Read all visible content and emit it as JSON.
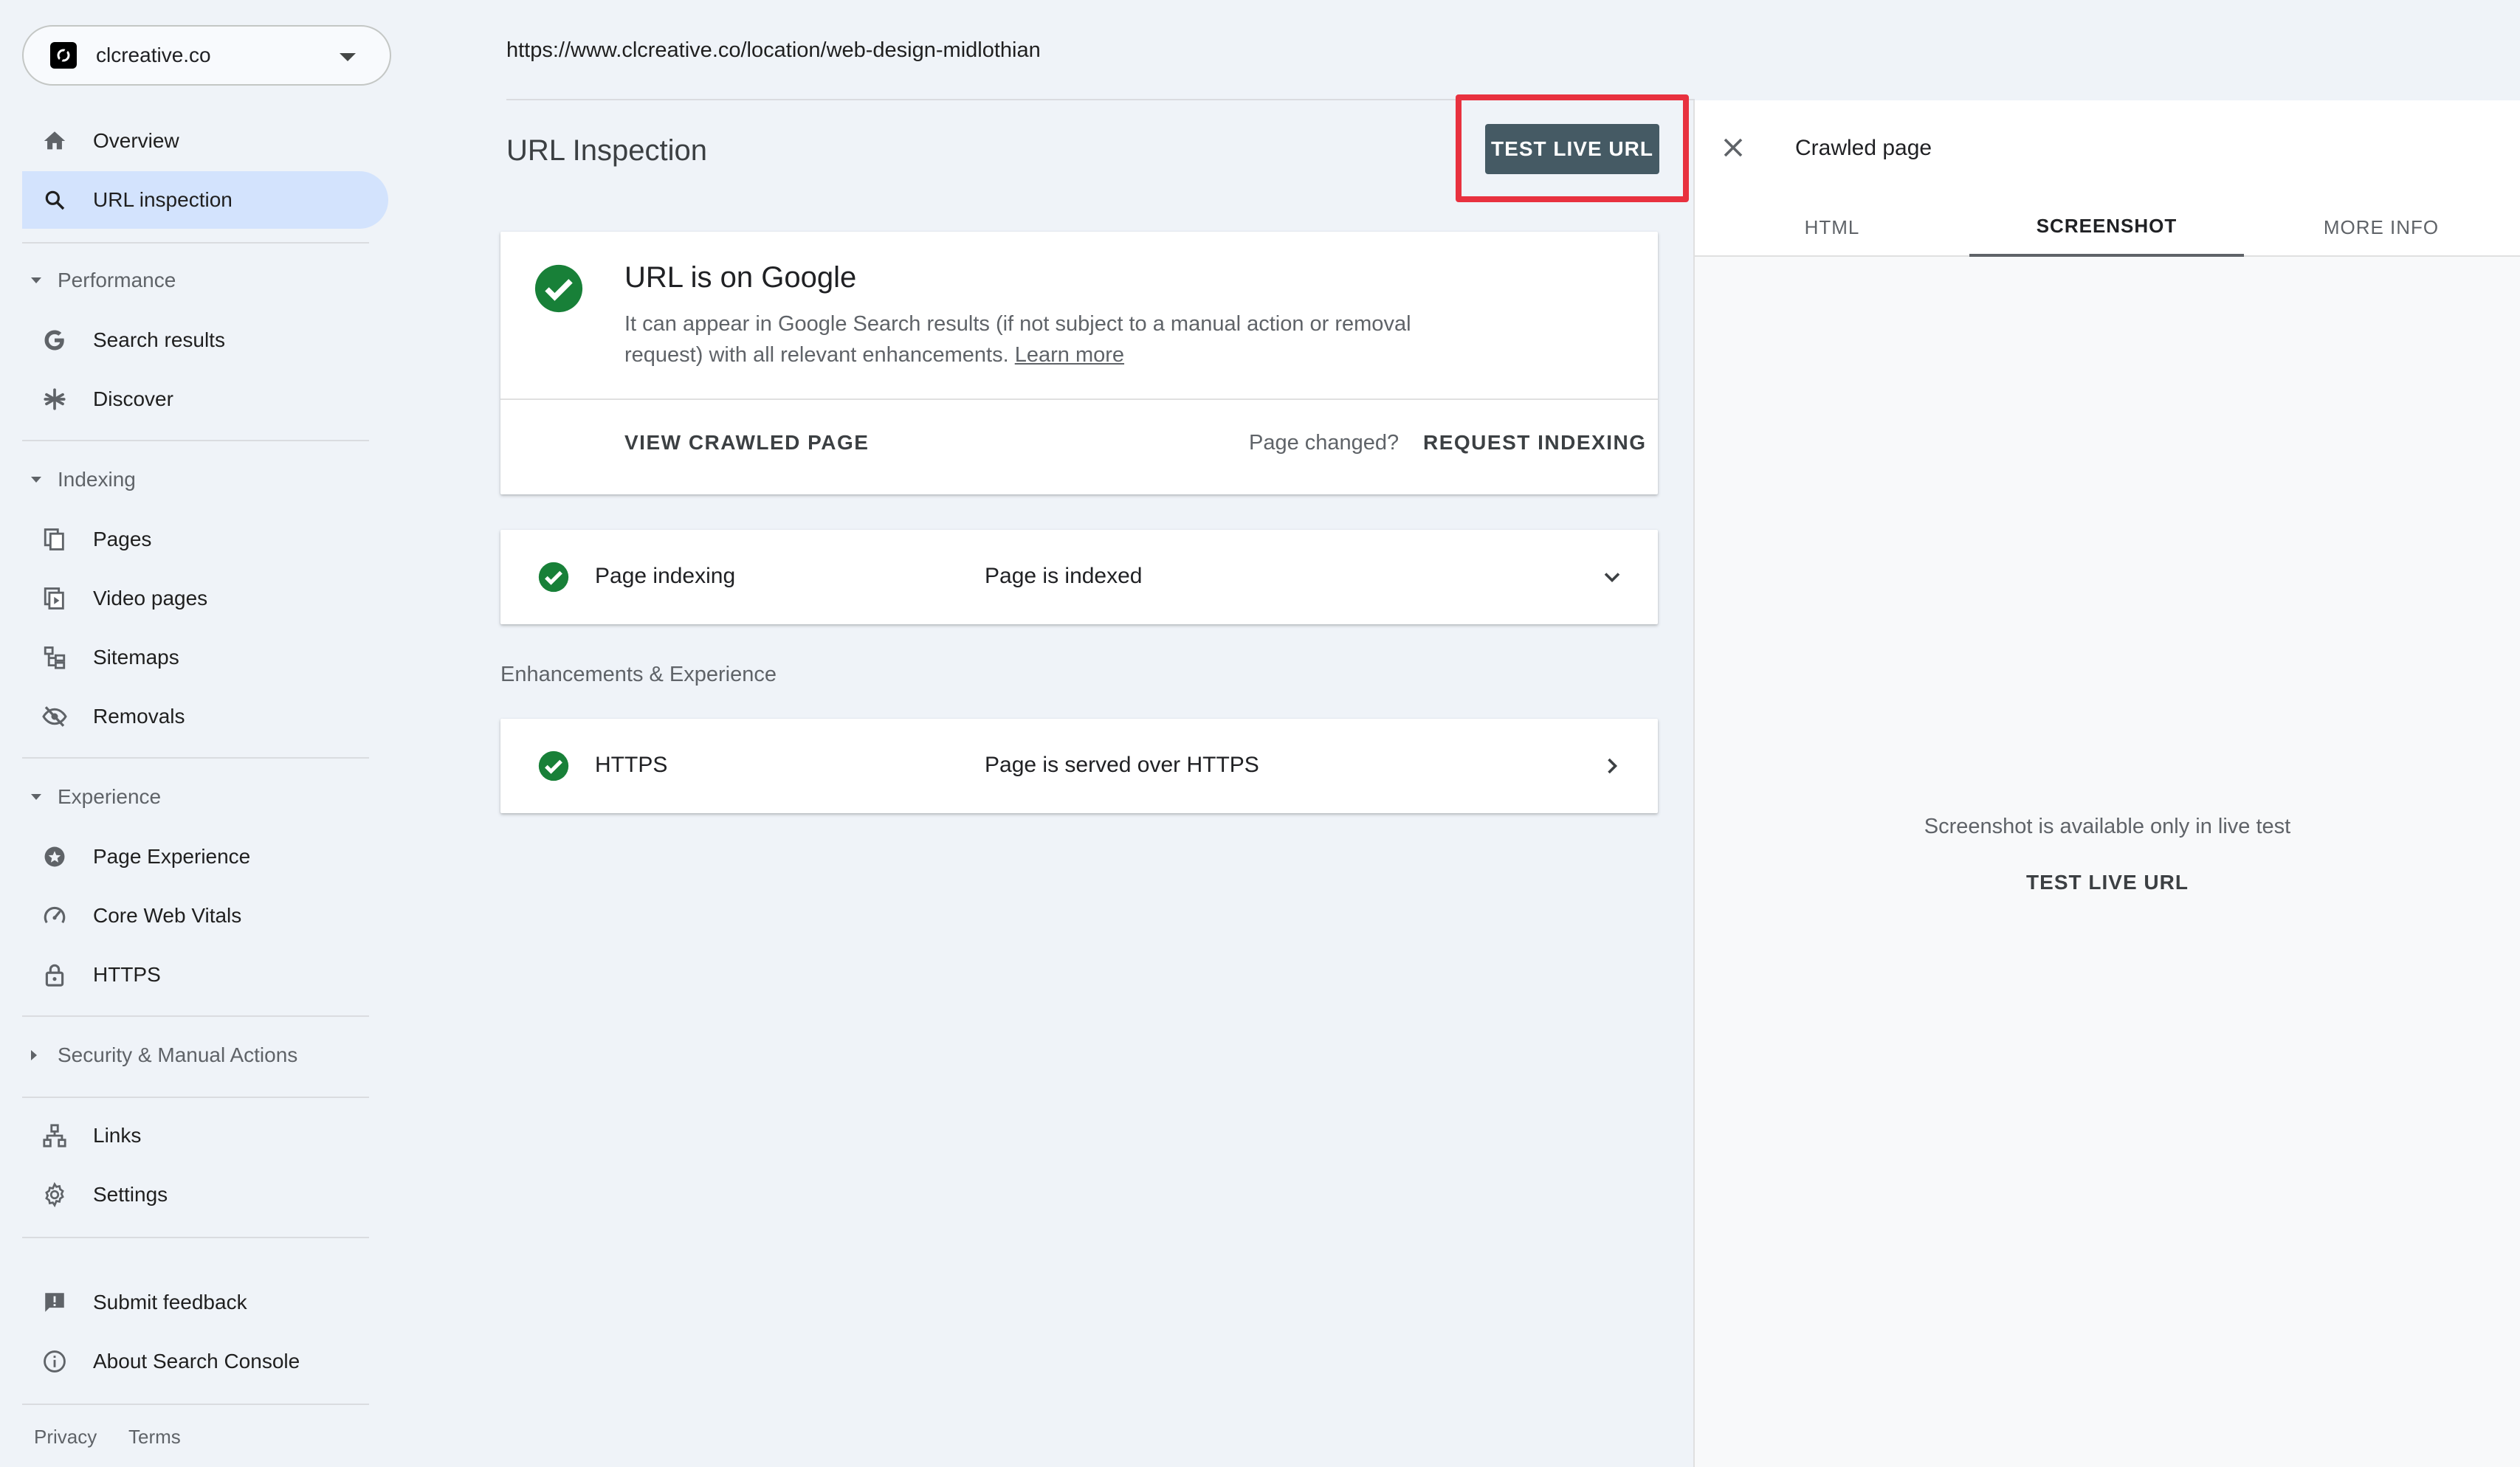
{
  "property": {
    "name": "clcreative.co"
  },
  "nav": {
    "overview": "Overview",
    "url_inspection": "URL inspection",
    "performance": {
      "section": "Performance",
      "search_results": "Search results",
      "discover": "Discover"
    },
    "indexing": {
      "section": "Indexing",
      "pages": "Pages",
      "video_pages": "Video pages",
      "sitemaps": "Sitemaps",
      "removals": "Removals"
    },
    "experience": {
      "section": "Experience",
      "page_experience": "Page Experience",
      "core_web_vitals": "Core Web Vitals",
      "https": "HTTPS"
    },
    "security": {
      "section": "Security & Manual Actions"
    },
    "links": "Links",
    "settings": "Settings",
    "submit_feedback": "Submit feedback",
    "about": "About Search Console",
    "footer": {
      "privacy": "Privacy",
      "terms": "Terms"
    }
  },
  "main": {
    "url": "https://www.clcreative.co/location/web-design-midlothian",
    "title": "URL Inspection",
    "test_live_url": "TEST LIVE URL",
    "status": {
      "title": "URL is on Google",
      "desc_line1": "It can appear in Google Search results (if not subject to a manual action or removal",
      "desc_line2": "request) with all relevant enhancements. ",
      "learn_more": "Learn more",
      "view_crawled": "VIEW CRAWLED PAGE",
      "page_changed": "Page changed?",
      "request_indexing": "REQUEST INDEXING"
    },
    "indexing_row": {
      "label": "Page indexing",
      "value": "Page is indexed"
    },
    "enhancements_caption": "Enhancements & Experience",
    "https_row": {
      "label": "HTTPS",
      "value": "Page is served over HTTPS"
    }
  },
  "panel": {
    "title": "Crawled page",
    "tabs": [
      "HTML",
      "SCREENSHOT",
      "MORE INFO"
    ],
    "active_tab": "SCREENSHOT",
    "message": "Screenshot is available only in live test",
    "link": "TEST LIVE URL"
  },
  "colors": {
    "accent_active_bg": "#d3e3fd",
    "button_bg": "#455a64",
    "highlight_border": "#e8313f",
    "success_green": "#188038"
  }
}
